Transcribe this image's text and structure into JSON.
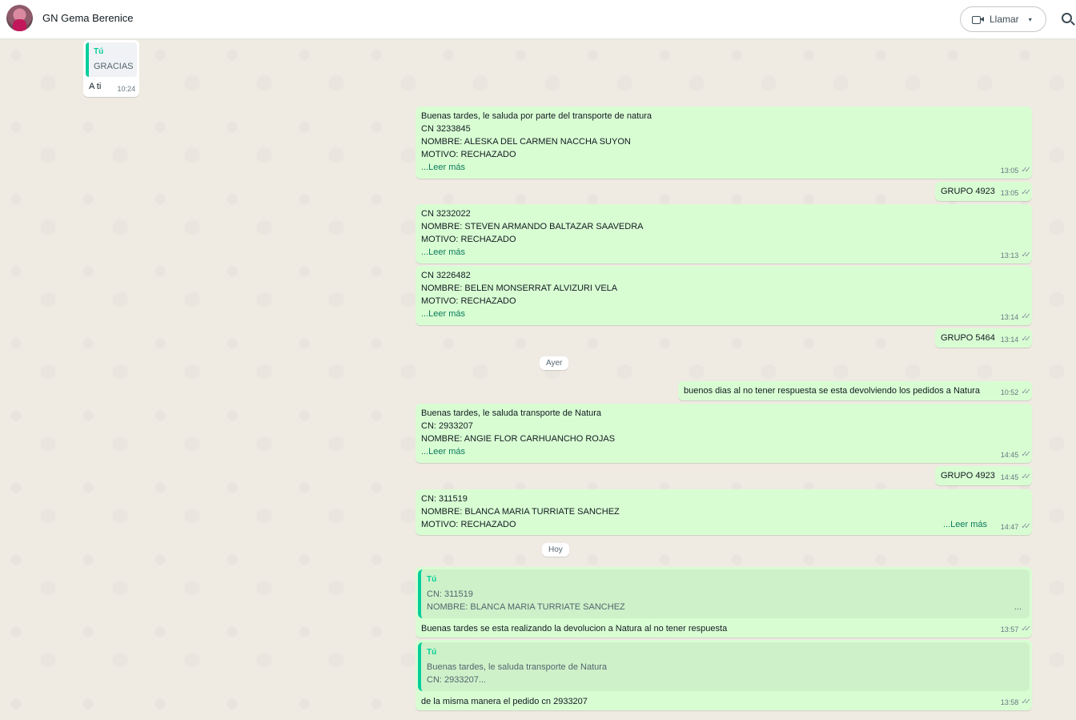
{
  "header": {
    "contact_name": "GN Gema Berenice",
    "call_label": "Llamar",
    "call_caret": "▾"
  },
  "icons": {
    "video": "video-camera-icon",
    "search": "search-icon",
    "ticks": "double-check-icon"
  },
  "colors": {
    "outgoing_bubble": "#d9fdd3",
    "incoming_bubble": "#ffffff",
    "accent": "#06cf9c",
    "chat_bg": "#efeae2"
  },
  "messages": {
    "m0": {
      "quote_author": "Tú",
      "quote_text": "GRACIAS",
      "text": "A ti",
      "time": "10:24"
    },
    "m1": {
      "lines": [
        "Buenas tardes, le saluda por parte del transporte de natura",
        "CN 3233845",
        "NOMBRE: ALESKA DEL CARMEN NACCHA SUYON",
        "MOTIVO: RECHAZADO"
      ],
      "more": "...Leer más",
      "time": "13:05"
    },
    "m2": {
      "text": "GRUPO 4923",
      "time": "13:05"
    },
    "m3": {
      "lines": [
        "CN 3232022",
        "NOMBRE: STEVEN ARMANDO BALTAZAR SAAVEDRA",
        "MOTIVO: RECHAZADO"
      ],
      "more": "...Leer más",
      "time": "13:13"
    },
    "m4": {
      "lines": [
        "CN 3226482",
        "NOMBRE: BELEN MONSERRAT ALVIZURI VELA",
        "MOTIVO: RECHAZADO"
      ],
      "more": "...Leer más",
      "time": "13:14"
    },
    "m5": {
      "text": "GRUPO 5464",
      "time": "13:14"
    },
    "sep1": "Ayer",
    "m6": {
      "text": "buenos dias al no tener respuesta se esta devolviendo los pedidos a Natura",
      "time": "10:52"
    },
    "m7": {
      "lines": [
        "Buenas tardes, le saluda transporte de Natura",
        "CN:    2933207",
        "NOMBRE:  ANGIE FLOR CARHUANCHO ROJAS"
      ],
      "more": "...Leer más",
      "time": "14:45"
    },
    "m8": {
      "text": "GRUPO 4923",
      "time": "14:45"
    },
    "m9": {
      "lines": [
        "CN: 311519",
        "NOMBRE:  BLANCA MARIA TURRIATE SANCHEZ",
        "MOTIVO: RECHAZADO"
      ],
      "more": "...Leer más",
      "time": "14:47"
    },
    "sep2": "Hoy",
    "m10": {
      "quote_author": "Tú",
      "quote_lines": [
        "CN: 311519",
        "NOMBRE:  BLANCA MARIA TURRIATE SANCHEZ"
      ],
      "quote_ellipsis": "...",
      "text": "Buenas tardes se esta realizando la devolucion a Natura al no tener respuesta",
      "time": "13:57"
    },
    "m11": {
      "quote_author": "Tú",
      "quote_lines": [
        "Buenas tardes, le saluda transporte de Natura",
        "CN:    2933207..."
      ],
      "text": "de la misma manera el pedido cn 2933207",
      "time": "13:58"
    }
  }
}
